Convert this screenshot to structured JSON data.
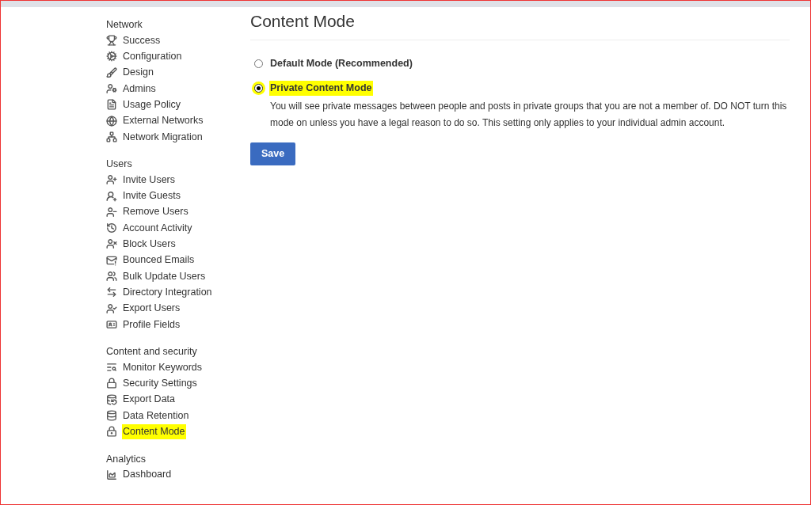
{
  "sidebar": {
    "sections": [
      {
        "heading": "Network",
        "items": [
          {
            "label": "Success",
            "selected": false
          },
          {
            "label": "Configuration",
            "selected": false
          },
          {
            "label": "Design",
            "selected": false
          },
          {
            "label": "Admins",
            "selected": false
          },
          {
            "label": "Usage Policy",
            "selected": false
          },
          {
            "label": "External Networks",
            "selected": false
          },
          {
            "label": "Network Migration",
            "selected": false
          }
        ]
      },
      {
        "heading": "Users",
        "items": [
          {
            "label": "Invite Users",
            "selected": false
          },
          {
            "label": "Invite Guests",
            "selected": false
          },
          {
            "label": "Remove Users",
            "selected": false
          },
          {
            "label": "Account Activity",
            "selected": false
          },
          {
            "label": "Block Users",
            "selected": false
          },
          {
            "label": "Bounced Emails",
            "selected": false
          },
          {
            "label": "Bulk Update Users",
            "selected": false
          },
          {
            "label": "Directory Integration",
            "selected": false
          },
          {
            "label": "Export Users",
            "selected": false
          },
          {
            "label": "Profile Fields",
            "selected": false
          }
        ]
      },
      {
        "heading": "Content and security",
        "items": [
          {
            "label": "Monitor Keywords",
            "selected": false
          },
          {
            "label": "Security Settings",
            "selected": false
          },
          {
            "label": "Export Data",
            "selected": false
          },
          {
            "label": "Data Retention",
            "selected": false
          },
          {
            "label": "Content Mode",
            "selected": true
          }
        ]
      },
      {
        "heading": "Analytics",
        "items": [
          {
            "label": "Dashboard",
            "selected": false
          }
        ]
      }
    ]
  },
  "main": {
    "title": "Content Mode",
    "options": [
      {
        "label": "Default Mode (Recommended)",
        "selected": false,
        "highlighted": false
      },
      {
        "label": "Private Content Mode",
        "selected": true,
        "highlighted": true,
        "description": "You will see private messages between people and posts in private groups that you are not a member of. DO NOT turn this mode on unless you have a legal reason to do so. This setting only applies to your individual admin account."
      }
    ],
    "save_button": "Save"
  }
}
